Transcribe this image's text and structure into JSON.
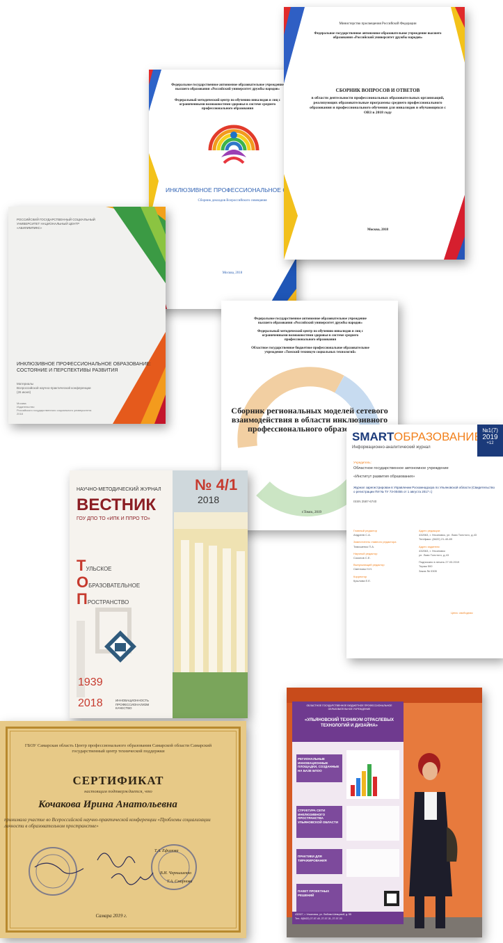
{
  "doc1": {
    "org": "Федеральное государственное автономное образовательное учреждение высшего образования «Российский университет дружбы народов»",
    "center": "Федеральный методический центр по обучению инвалидов и лиц с ограниченными возможностями здоровья в системе среднего профессионального образования",
    "banner": "ИНКЛЮЗИВНОЕ ПРОФЕССИОНАЛЬНОЕ ОБРАЗОВАНИЕ",
    "subtitle": "Сборник докладов Всероссийского совещания",
    "city": "Москва, 2018"
  },
  "doc2": {
    "ministry": "Министерство просвещения Российской Федерации",
    "org": "Федеральное государственное автономное образовательное учреждение высшего образования «Российский университет дружбы народов»",
    "title": "СБОРНИК ВОПРОСОВ И ОТВЕТОВ",
    "body": "в области деятельности профессиональных образовательных организаций, реализующих образовательные программы среднего профессионального образования и профессионального обучения для инвалидов и обучающихся с ОВЗ в 2018 году",
    "city": "Москва, 2018"
  },
  "doc3": {
    "org": "РОССИЙСКИЙ ГОСУДАРСТВЕННЫЙ СОЦИАЛЬНЫЙ УНИВЕРСИТЕТ НАЦИОНАЛЬНЫЙ ЦЕНТР «АБИЛИМПИКС»",
    "title": "ИНКЛЮЗИВНОЕ ПРОФЕССИОНАЛЬНОЕ ОБРАЗОВАНИЕ: СОСТОЯНИЕ И ПЕРСПЕКТИВЫ РАЗВИТИЯ",
    "sub1": "Материалы",
    "sub2": "Всероссийской научно-практической конференции",
    "sub3": "(26 июня)",
    "foot1": "Москва",
    "foot2": "Издательство",
    "foot3": "Российского государственного социального университета",
    "foot4": "2018"
  },
  "doc4": {
    "org1": "Федеральное государственное автономное образовательное учреждение высшего образования «Российский университет дружбы народов»",
    "org2": "Федеральный методический центр по обучению инвалидов и лиц с ограниченными возможностями здоровья в системе среднего профессионального образования",
    "org3": "Областное государственное бюджетное профессиональное образовательное учреждение «Томский техникум социальных технологий»",
    "title": "Сборник региональных моделей сетевого взаимодействия в области инклюзивного профессионального образования",
    "city": "г.Томск, 2019"
  },
  "doc5": {
    "brand_a": "SMART",
    "brand_b": "ОБРАЗОВАНИЕ",
    "issue": "№1(7)",
    "year": "2019",
    "plus": "+12",
    "subtitle": "Информационно-аналитический журнал",
    "founder_label": "Учредитель:",
    "founder": "Областное государственное автономное учреждение",
    "founder2": "«Институт развития образования»",
    "reg": "Журнал зарегистрирован в Управлении Роскомнадзора по Ульяновской области (Свидетельство о регистрации ПИ № ТУ 73-00455 от 1 августа 2017 г.)",
    "issn": "ISSN 2587-6740",
    "col_left": [
      "Главный редактор",
      "Андреев С.А.",
      "Заместитель главного редактора",
      "Тимошенко П.А.",
      "Научный редактор",
      "Соколов С.Е.",
      "Выпускающий редактор",
      "Светлова Н.Н.",
      "Корректор",
      "Крылова Е.Е."
    ],
    "col_right": [
      "Адрес редакции:",
      "432063, г. Ульяновск, ул. Льва Толстого, д.43",
      "Тел/факс: (8422) 21-40-89",
      "Адрес издателя:",
      "432063, г. Ульяновск",
      "ул. Льва Толстого, д.43",
      "Подписано в печать 27.03.2019",
      "Тираж 500",
      "Заказ № 0305"
    ],
    "price": "Цена: свободная"
  },
  "doc6": {
    "journal": "НАУЧНО-МЕТОДИЧЕСКИЙ ЖУРНАЛ",
    "name": "ВЕСТНИК",
    "org": "ГОУ ДПО ТО «ИПК И ППРО ТО»",
    "issue": "№ 4/1",
    "year": "2018",
    "line1": "УЛЬСКОЕ",
    "line2": "БРАЗОВАТЕЛЬНОЕ",
    "line3": "РОСТРАНСТВО",
    "letter1": "Т",
    "letter2": "О",
    "letter3": "П",
    "since": "1939",
    "now": "2018",
    "motto": "ИННОВАЦИОННОСТЬ ПРОФЕССИОНАЛИЗМ КАЧЕСТВО"
  },
  "doc7": {
    "org": "ГБОУ Самарская область Центр профессионального образования Самарской области Самарский государственный центр технической поддержки",
    "title": "СЕРТИФИКАТ",
    "confirm": "настоящим подтверждается, что",
    "name": "Кочакова Ирина Анатольевна",
    "text": "принимала участие во Всероссийской научно-практической конференции «Проблемы социализации личности в образовательном пространстве»",
    "sig1": "Т.А. Ефимова",
    "sig2": "В.И. Чернышенко",
    "sig3": "Т.А. Смирнова",
    "city": "Самара 2019 г."
  },
  "doc8": {
    "header": "ОБЛАСТНОЕ ГОСУДАРСТВЕННОЕ БЮДЖЕТНОЕ ПРОФЕССИОНАЛЬНОЕ ОБРАЗОВАТЕЛЬНОЕ УЧРЕЖДЕНИЕ",
    "title": "«УЛЬЯНОВСКИЙ ТЕХНИКУМ ОТРАСЛЕВЫХ ТЕХНОЛОГИЙ И ДИЗАЙНА»",
    "s1": "РЕГИОНАЛЬНЫЕ ИННОВАЦИОННЫЕ ПЛОЩАДКИ, СОЗДАННЫЕ НА БАЗЕ БПОО",
    "s2": "СТРУКТУРА СЕТИ ИНКЛЮЗИВНОГО ПРОСТРАНСТВА УЛЬЯНОВСКОЙ ОБЛАСТИ",
    "s3": "ПРАКТИКИ ДЛЯ ТИРАЖИРОВАНИЯ",
    "s4": "ПАКЕТ ПРОЕКТНЫХ РЕШЕНИЙ",
    "address": "432027, г. Ульяновск, ул. Любови Шевцовой, д. 55",
    "contacts": "Тел.: 8(8422) 27-07-40, 27-07-31, 27-07-33"
  }
}
